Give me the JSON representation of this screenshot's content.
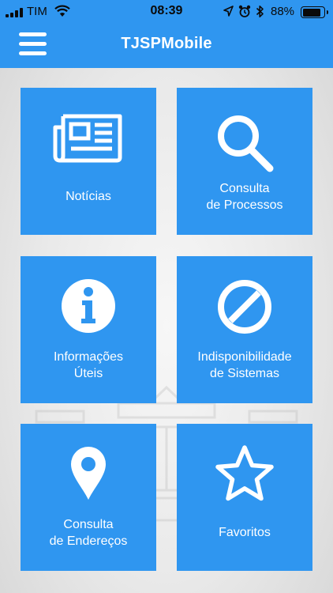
{
  "status_bar": {
    "carrier": "TIM",
    "time": "08:39",
    "battery_percent": "88%",
    "battery_level": 0.88,
    "icons": [
      "signal-icon",
      "wifi-icon",
      "location-icon",
      "alarm-icon",
      "bluetooth-icon",
      "battery-icon"
    ]
  },
  "header": {
    "title": "TJSPMobile",
    "menu_icon": "hamburger-menu-icon"
  },
  "colors": {
    "primary": "#2f96f0",
    "tile_text": "#ffffff",
    "background": "#e9e9e9"
  },
  "tiles": [
    {
      "label": "Notícias",
      "icon": "newspaper-icon"
    },
    {
      "label": "Consulta\nde Processos",
      "icon": "search-icon"
    },
    {
      "label": "Informações\nÚteis",
      "icon": "info-icon"
    },
    {
      "label": "Indisponibilidade\nde Sistemas",
      "icon": "prohibited-icon"
    },
    {
      "label": "Consulta\nde Endereços",
      "icon": "map-pin-icon"
    },
    {
      "label": "Favoritos",
      "icon": "star-icon"
    }
  ]
}
